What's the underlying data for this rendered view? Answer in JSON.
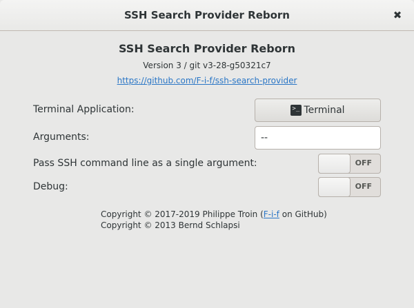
{
  "window": {
    "title": "SSH Search Provider Reborn",
    "close_glyph": "✖"
  },
  "about": {
    "name": "SSH Search Provider Reborn",
    "version": "Version 3 / git v3-28-g50321c7",
    "url": "https://github.com/F-i-f/ssh-search-provider"
  },
  "settings": {
    "terminal": {
      "label": "Terminal Application:",
      "button_label": "Terminal",
      "icon": "terminal-icon"
    },
    "arguments": {
      "label": "Arguments:",
      "value": "--"
    },
    "single_arg": {
      "label": "Pass SSH command line as a single argument:",
      "state": "OFF"
    },
    "debug": {
      "label": "Debug:",
      "state": "OFF"
    }
  },
  "copyright": {
    "line1_prefix": "Copyright © 2017-2019 Philippe Troin (",
    "line1_link": "F-i-f",
    "line1_suffix": " on GitHub)",
    "line2": "Copyright © 2013 Bernd Schlapsi"
  },
  "colors": {
    "link": "#2a76c6",
    "background": "#e8e8e7",
    "text": "#2e3436"
  }
}
